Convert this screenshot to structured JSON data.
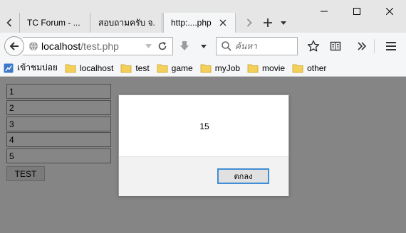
{
  "browser": {
    "tabs": [
      {
        "label": "TC Forum - ..."
      },
      {
        "label": "สอบถามครับ จ..."
      },
      {
        "label": "http:....php",
        "active": true
      }
    ],
    "url": {
      "host": "localhost",
      "path": "/test.php"
    },
    "search": {
      "placeholder": "ค้นหา"
    },
    "bookmarks": [
      {
        "label": "เข้าชมบ่อย",
        "icon": "most-visited-icon"
      },
      {
        "label": "localhost",
        "icon": "folder-icon"
      },
      {
        "label": "test",
        "icon": "folder-icon"
      },
      {
        "label": "game",
        "icon": "folder-icon"
      },
      {
        "label": "myJob",
        "icon": "folder-icon"
      },
      {
        "label": "movie",
        "icon": "folder-icon"
      },
      {
        "label": "other",
        "icon": "folder-icon"
      }
    ]
  },
  "page": {
    "inputs": [
      "1",
      "2",
      "3",
      "4",
      "5"
    ],
    "button_label": "TEST"
  },
  "dialog": {
    "message": "15",
    "ok_label": "ตกลง"
  },
  "colors": {
    "overlay": "#858585",
    "accent": "#3f8ed6",
    "folder": "#f4d05a"
  }
}
